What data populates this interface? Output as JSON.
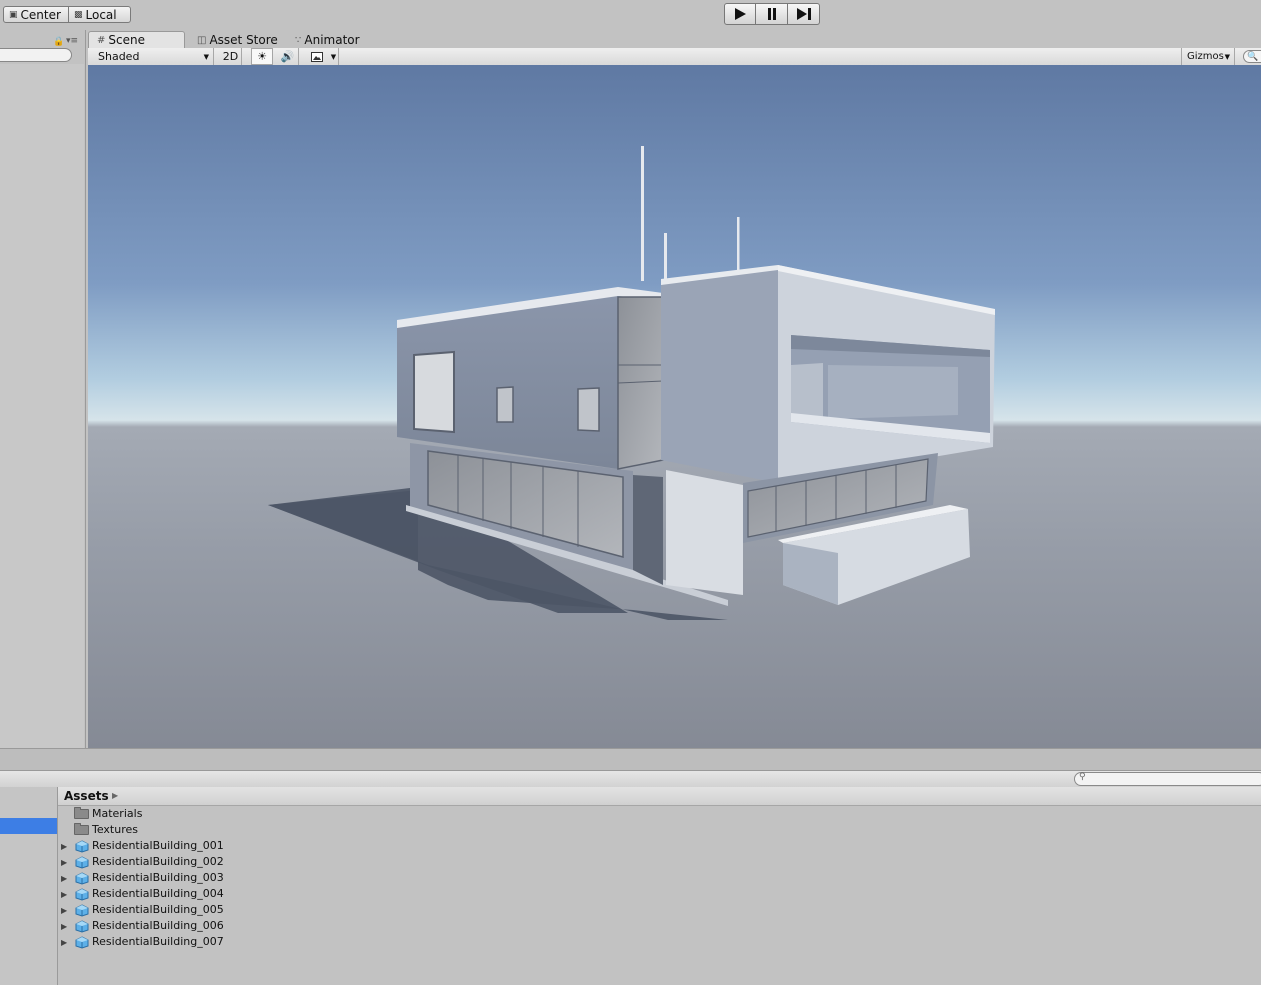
{
  "toolbar": {
    "pivot_label": "Center",
    "space_label": "Local",
    "play_icon": "play-icon",
    "pause_icon": "pause-icon",
    "step_icon": "step-icon"
  },
  "scene": {
    "tabs": [
      {
        "label": "Scene",
        "icon": "grid-icon"
      },
      {
        "label": "Asset Store",
        "icon": "store-icon"
      },
      {
        "label": "Animator",
        "icon": "animator-icon"
      }
    ],
    "draw_mode": "Shaded",
    "mode_2d": "2D",
    "gizmos_label": "Gizmos"
  },
  "project": {
    "breadcrumb": "Assets",
    "items": [
      {
        "name": "Materials",
        "type": "folder"
      },
      {
        "name": "Textures",
        "type": "folder"
      },
      {
        "name": "ResidentialBuilding_001",
        "type": "prefab"
      },
      {
        "name": "ResidentialBuilding_002",
        "type": "prefab"
      },
      {
        "name": "ResidentialBuilding_003",
        "type": "prefab"
      },
      {
        "name": "ResidentialBuilding_004",
        "type": "prefab"
      },
      {
        "name": "ResidentialBuilding_005",
        "type": "prefab"
      },
      {
        "name": "ResidentialBuilding_006",
        "type": "prefab"
      },
      {
        "name": "ResidentialBuilding_007",
        "type": "prefab"
      }
    ]
  },
  "colors": {
    "selection": "#3d7ee5",
    "sky_top": "#5f7aa5",
    "horizon": "#d2e0e9",
    "ground": "#8b909b"
  }
}
